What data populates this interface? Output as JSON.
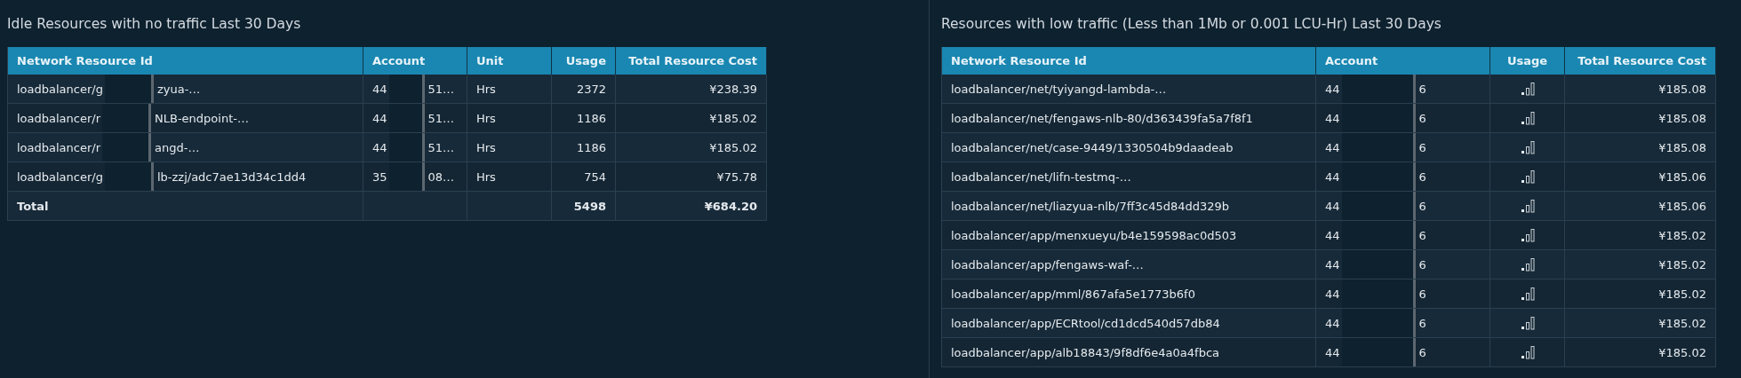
{
  "panels": [
    {
      "title": "Idle Resources with no traffic Last 30 Days",
      "columns": [
        {
          "label": "Network Resource Id"
        },
        {
          "label": "Account"
        },
        {
          "label": "Unit"
        },
        {
          "label": "Usage"
        },
        {
          "label": "Total Resource Cost"
        }
      ],
      "rows": [
        {
          "kind": "data",
          "cells": [
            {
              "kind": "split",
              "before": "loadbalancer/g",
              "after": "zyua-…"
            },
            {
              "kind": "split",
              "before": "44",
              "after": "51…"
            },
            {
              "kind": "text",
              "text": "Hrs"
            },
            {
              "kind": "text",
              "text": "2372"
            },
            {
              "kind": "text",
              "text": "¥238.39"
            }
          ]
        },
        {
          "kind": "data",
          "cells": [
            {
              "kind": "split",
              "before": "loadbalancer/r",
              "after": "NLB-endpoint-…"
            },
            {
              "kind": "split",
              "before": "44",
              "after": "51…"
            },
            {
              "kind": "text",
              "text": "Hrs"
            },
            {
              "kind": "text",
              "text": "1186"
            },
            {
              "kind": "text",
              "text": "¥185.02"
            }
          ]
        },
        {
          "kind": "data",
          "cells": [
            {
              "kind": "split",
              "before": "loadbalancer/r",
              "after": "angd-…"
            },
            {
              "kind": "split",
              "before": "44",
              "after": "51…"
            },
            {
              "kind": "text",
              "text": "Hrs"
            },
            {
              "kind": "text",
              "text": "1186"
            },
            {
              "kind": "text",
              "text": "¥185.02"
            }
          ]
        },
        {
          "kind": "data",
          "cells": [
            {
              "kind": "split",
              "before": "loadbalancer/g",
              "after": "lb-zzj/adc7ae13d34c1dd4"
            },
            {
              "kind": "split",
              "before": "35",
              "after": "08…"
            },
            {
              "kind": "text",
              "text": "Hrs"
            },
            {
              "kind": "text",
              "text": "754"
            },
            {
              "kind": "text",
              "text": "¥75.78"
            }
          ]
        },
        {
          "kind": "total",
          "cells": [
            {
              "kind": "text",
              "text": "Total"
            },
            {
              "kind": "empty"
            },
            {
              "kind": "empty"
            },
            {
              "kind": "text",
              "text": "5498"
            },
            {
              "kind": "text",
              "text": "¥684.20"
            }
          ]
        }
      ]
    },
    {
      "title": "Resources with low traffic (Less than 1Mb or 0.001 LCU-Hr) Last 30 Days",
      "columns": [
        {
          "label": "Network Resource Id"
        },
        {
          "label": "Account"
        },
        {
          "label": "Usage"
        },
        {
          "label": "Total Resource Cost"
        }
      ],
      "rows": [
        {
          "kind": "data",
          "cells": [
            {
              "kind": "text",
              "text": "loadbalancer/net/tyiyangd-lambda-…"
            },
            {
              "kind": "split",
              "before": "44",
              "after": "6"
            },
            {
              "kind": "bars"
            },
            {
              "kind": "text",
              "text": "¥185.08"
            }
          ]
        },
        {
          "kind": "data",
          "cells": [
            {
              "kind": "text",
              "text": "loadbalancer/net/fengaws-nlb-80/d363439fa5a7f8f1"
            },
            {
              "kind": "split",
              "before": "44",
              "after": "6"
            },
            {
              "kind": "bars"
            },
            {
              "kind": "text",
              "text": "¥185.08"
            }
          ]
        },
        {
          "kind": "data",
          "cells": [
            {
              "kind": "text",
              "text": "loadbalancer/net/case-9449/1330504b9daadeab"
            },
            {
              "kind": "split",
              "before": "44",
              "after": "6"
            },
            {
              "kind": "bars"
            },
            {
              "kind": "text",
              "text": "¥185.08"
            }
          ]
        },
        {
          "kind": "data",
          "cells": [
            {
              "kind": "text",
              "text": "loadbalancer/net/lifn-testmq-…"
            },
            {
              "kind": "split",
              "before": "44",
              "after": "6"
            },
            {
              "kind": "bars"
            },
            {
              "kind": "text",
              "text": "¥185.06"
            }
          ]
        },
        {
          "kind": "data",
          "cells": [
            {
              "kind": "text",
              "text": "loadbalancer/net/liazyua-nlb/7ff3c45d84dd329b"
            },
            {
              "kind": "split",
              "before": "44",
              "after": "6"
            },
            {
              "kind": "bars"
            },
            {
              "kind": "text",
              "text": "¥185.06"
            }
          ]
        },
        {
          "kind": "data",
          "cells": [
            {
              "kind": "text",
              "text": "loadbalancer/app/menxueyu/b4e159598ac0d503"
            },
            {
              "kind": "split",
              "before": "44",
              "after": "6"
            },
            {
              "kind": "bars"
            },
            {
              "kind": "text",
              "text": "¥185.02"
            }
          ]
        },
        {
          "kind": "data",
          "cells": [
            {
              "kind": "text",
              "text": "loadbalancer/app/fengaws-waf-…"
            },
            {
              "kind": "split",
              "before": "44",
              "after": "6"
            },
            {
              "kind": "bars"
            },
            {
              "kind": "text",
              "text": "¥185.02"
            }
          ]
        },
        {
          "kind": "data",
          "cells": [
            {
              "kind": "text",
              "text": "loadbalancer/app/mml/867afa5e1773b6f0"
            },
            {
              "kind": "split",
              "before": "44",
              "after": "6"
            },
            {
              "kind": "bars"
            },
            {
              "kind": "text",
              "text": "¥185.02"
            }
          ]
        },
        {
          "kind": "data",
          "cells": [
            {
              "kind": "text",
              "text": "loadbalancer/app/ECRtool/cd1dcd540d57db84"
            },
            {
              "kind": "split",
              "before": "44",
              "after": "6"
            },
            {
              "kind": "bars"
            },
            {
              "kind": "text",
              "text": "¥185.02"
            }
          ]
        },
        {
          "kind": "data",
          "cells": [
            {
              "kind": "text",
              "text": "loadbalancer/app/alb18843/9f8df6e4a0a4fbca"
            },
            {
              "kind": "split",
              "before": "44",
              "after": "6"
            },
            {
              "kind": "bars"
            },
            {
              "kind": "text",
              "text": "¥185.02"
            }
          ]
        }
      ]
    }
  ]
}
